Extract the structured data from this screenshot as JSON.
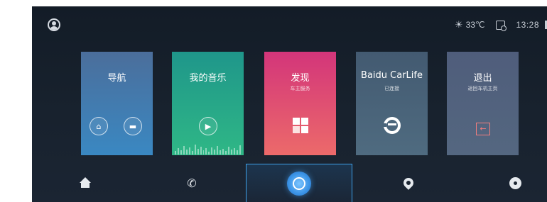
{
  "status_bar": {
    "weather_icon": "sun-cloud-icon",
    "temperature": "33℃",
    "device_icon": "phone-link-icon",
    "time": "13:28"
  },
  "cards": [
    {
      "title": "导航",
      "subtitle": "",
      "buttons": [
        "home-icon",
        "briefcase-icon"
      ]
    },
    {
      "title": "我的音乐",
      "subtitle": "",
      "buttons": [
        "play-icon"
      ]
    },
    {
      "title": "发现",
      "subtitle": "车主服务",
      "icon": "grid-icon"
    },
    {
      "title": "Baidu CarLife",
      "subtitle": "已连接",
      "icon": "carlife-icon"
    },
    {
      "title": "退出",
      "subtitle": "返回车机主页",
      "icon": "exit-arrow-icon"
    }
  ],
  "dock": {
    "items": [
      "home-icon",
      "phone-icon",
      "voice-assistant-icon",
      "location-pin-icon",
      "music-disc-icon"
    ],
    "active": "voice-assistant-icon"
  },
  "colors": {
    "background": "#18222e",
    "nav": "#3a88c2",
    "music": "#2fb786",
    "discover": "#e0456f",
    "carlife": "#4a657b",
    "exit": "#536580",
    "accent": "#3ea0e8"
  },
  "glyphs": {
    "play": "▶",
    "arrow_left": "←",
    "phone": "✆"
  }
}
